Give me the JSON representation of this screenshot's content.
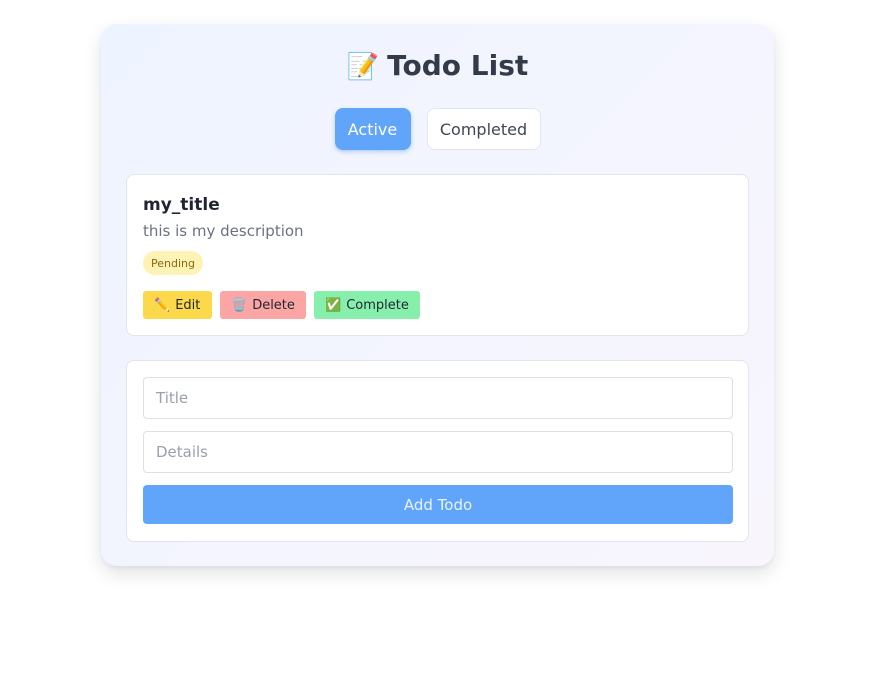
{
  "header": {
    "title_emoji": "📝",
    "title": "Todo List"
  },
  "tabs": [
    {
      "label": "Active",
      "selected": true
    },
    {
      "label": "Completed",
      "selected": false
    }
  ],
  "todos": [
    {
      "title": "my_title",
      "description": "this is my description",
      "status": "Pending",
      "actions": {
        "edit": {
          "icon": "✏️",
          "label": "Edit"
        },
        "delete": {
          "icon": "🗑️",
          "label": "Delete"
        },
        "complete": {
          "icon": "✅",
          "label": "Complete"
        }
      }
    }
  ],
  "form": {
    "title_value": "",
    "title_placeholder": "Title",
    "details_value": "",
    "details_placeholder": "Details",
    "submit_label": "Add Todo"
  },
  "colors": {
    "accent": "#60a5fa",
    "edit": "#fcd94a",
    "delete": "#fca5a5",
    "complete": "#86efac",
    "badge_pending": "#fef3b4"
  }
}
